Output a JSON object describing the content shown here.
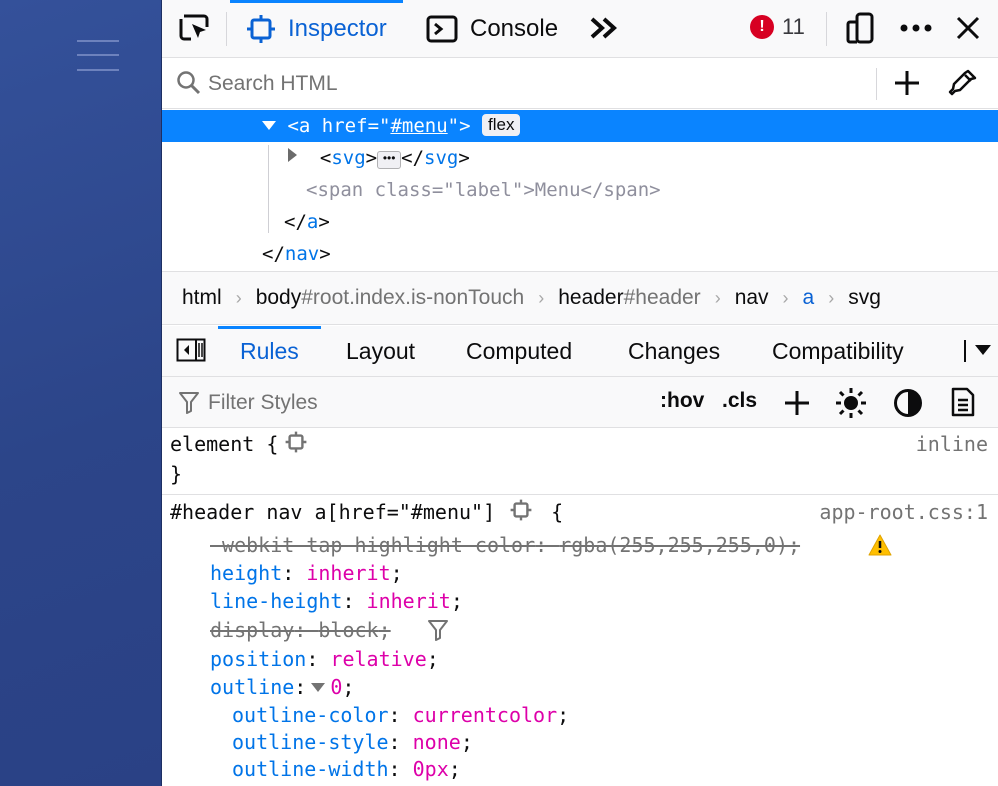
{
  "toolbar": {
    "tabs": [
      {
        "label": "Inspector",
        "selected": true
      },
      {
        "label": "Console",
        "selected": false
      }
    ],
    "error_count": "11"
  },
  "search": {
    "placeholder": "Search HTML",
    "value": ""
  },
  "markup": {
    "selected_line": {
      "open": "<",
      "tag": "a",
      "attr": " href",
      "eq": "=\"",
      "value": "#menu",
      "close": "\">",
      "badge": "flex"
    },
    "svg_line": {
      "open": "<",
      "tag": "svg",
      "close": ">",
      "end_open": "</",
      "end_close": ">"
    },
    "span_line": {
      "text": "<span class=\"label\">Menu</span>"
    },
    "close_a": {
      "open": "</",
      "tag": "a",
      "close": ">"
    },
    "close_nav": {
      "open": "</",
      "tag": "nav",
      "close": ">"
    }
  },
  "breadcrumbs": [
    {
      "tag": "html",
      "id": ""
    },
    {
      "tag": "body",
      "id": "#root.index.is-nonTouch"
    },
    {
      "tag": "header",
      "id": "#header"
    },
    {
      "tag": "nav",
      "id": ""
    },
    {
      "tag": "a",
      "id": ""
    },
    {
      "tag": "svg",
      "id": ""
    }
  ],
  "sidebar_tabs": [
    "Rules",
    "Layout",
    "Computed",
    "Changes",
    "Compatibility"
  ],
  "filter": {
    "placeholder": "Filter Styles",
    "hov": ":hov",
    "cls": ".cls"
  },
  "rules": {
    "element": {
      "selector": "element",
      "open": "{",
      "close": "}",
      "source": "inline"
    },
    "menu_rule": {
      "selector": "#header nav a[href=\"#menu\"]",
      "open": "{",
      "source": "app-root.css:1",
      "declarations": [
        {
          "name": "-webkit-tap-highlight-color",
          "value": "rgba(255,255,255,0)",
          "overridden": true
        },
        {
          "name": "height",
          "value": "inherit",
          "overridden": false
        },
        {
          "name": "line-height",
          "value": "inherit",
          "overridden": false
        },
        {
          "name": "display",
          "value": "block",
          "overridden": true
        },
        {
          "name": "position",
          "value": "relative",
          "overridden": false
        },
        {
          "name": "outline",
          "value": "0",
          "overridden": false
        },
        {
          "name": "outline-color",
          "value": "currentcolor",
          "overridden": false
        },
        {
          "name": "outline-style",
          "value": "none",
          "overridden": false
        },
        {
          "name": "outline-width",
          "value": "0px",
          "overridden": false
        }
      ]
    }
  },
  "colors": {
    "accent": "#0a84ff",
    "selected_text": "#0a62d4",
    "property": "#0074e8",
    "value": "#dd00a9",
    "error": "#d70022",
    "page_bg": "#2c4589"
  }
}
